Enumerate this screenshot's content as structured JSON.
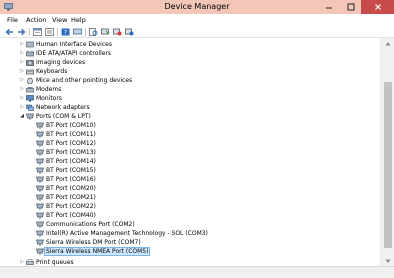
{
  "window": {
    "title": "Device Manager"
  },
  "menu": [
    "File",
    "Action",
    "View",
    "Help"
  ],
  "toolbar": {
    "buttons": [
      "back-icon",
      "forward-icon",
      "properties-icon",
      "help-icon",
      "show-device-icon",
      "scan-hardware-icon",
      "update-driver-icon",
      "disable-device-icon",
      "uninstall-device-icon"
    ]
  },
  "tree": {
    "categories": [
      {
        "label": "Human Interface Devices",
        "expanded": false,
        "icon": "hid-icon"
      },
      {
        "label": "IDE ATA/ATAPI controllers",
        "expanded": false,
        "icon": "ide-controller-icon"
      },
      {
        "label": "Imaging devices",
        "expanded": false,
        "icon": "camera-icon"
      },
      {
        "label": "Keyboards",
        "expanded": false,
        "icon": "keyboard-icon"
      },
      {
        "label": "Mice and other pointing devices",
        "expanded": false,
        "icon": "mouse-icon"
      },
      {
        "label": "Modems",
        "expanded": false,
        "icon": "modem-icon"
      },
      {
        "label": "Monitors",
        "expanded": false,
        "icon": "monitor-icon"
      },
      {
        "label": "Network adapters",
        "expanded": false,
        "icon": "network-adapter-icon"
      },
      {
        "label": "Ports (COM & LPT)",
        "expanded": true,
        "icon": "port-icon"
      }
    ],
    "ports": [
      "BT Port (COM10)",
      "BT Port (COM11)",
      "BT Port (COM12)",
      "BT Port (COM13)",
      "BT Port (COM14)",
      "BT Port (COM15)",
      "BT Port (COM16)",
      "BT Port (COM20)",
      "BT Port (COM21)",
      "BT Port (COM22)",
      "BT Port (COM40)",
      "Communications Port (COM2)",
      "Intel(R) Active Management Technology - SOL (COM3)",
      "Sierra Wireless DM Port (COM7)",
      "Sierra Wireless NMEA Port (COM5)"
    ],
    "selected": "Sierra Wireless NMEA Port (COM5)",
    "trailing": [
      {
        "label": "Print queues",
        "expanded": false,
        "icon": "printer-icon"
      }
    ]
  },
  "colors": {
    "titlebar": "#f3c6b8",
    "close": "#c74b4b",
    "selection": "#cde8ff",
    "selection_border": "#7eb4ea"
  }
}
